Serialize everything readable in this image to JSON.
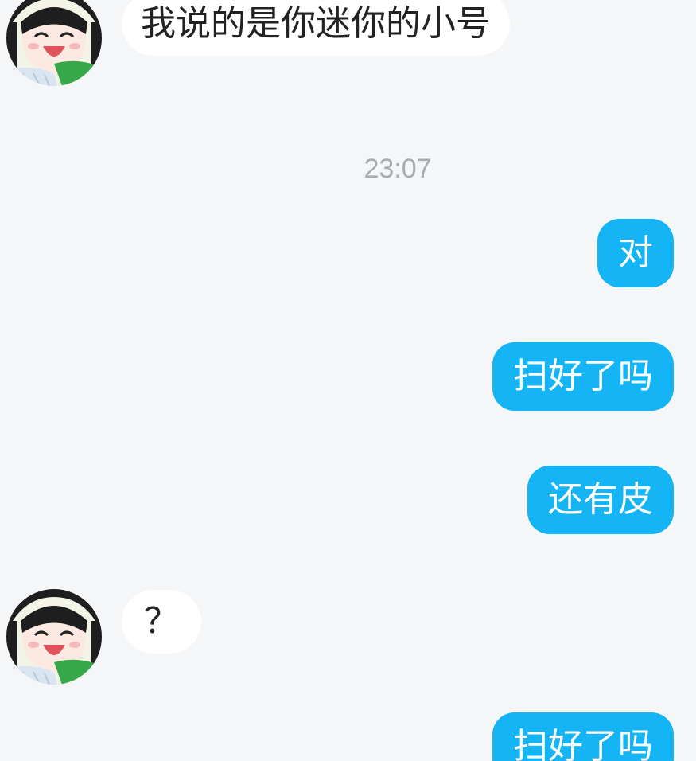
{
  "messages": [
    {
      "direction": "incoming",
      "text": "我说的是你迷你的小号"
    },
    {
      "direction": "outgoing",
      "text": "对"
    },
    {
      "direction": "outgoing",
      "text": "扫好了吗"
    },
    {
      "direction": "outgoing",
      "text": "还有皮"
    },
    {
      "direction": "incoming",
      "text": "？"
    },
    {
      "direction": "outgoing",
      "text": "扫好了吗"
    }
  ],
  "timestamp": "23:07",
  "icons": {
    "contact_avatar": "anime-girl-avatar"
  },
  "colors": {
    "background": "#f4f6f8",
    "incoming_bubble": "#ffffff",
    "outgoing_bubble": "#14b4f5",
    "timestamp_text": "#a9abb0"
  }
}
